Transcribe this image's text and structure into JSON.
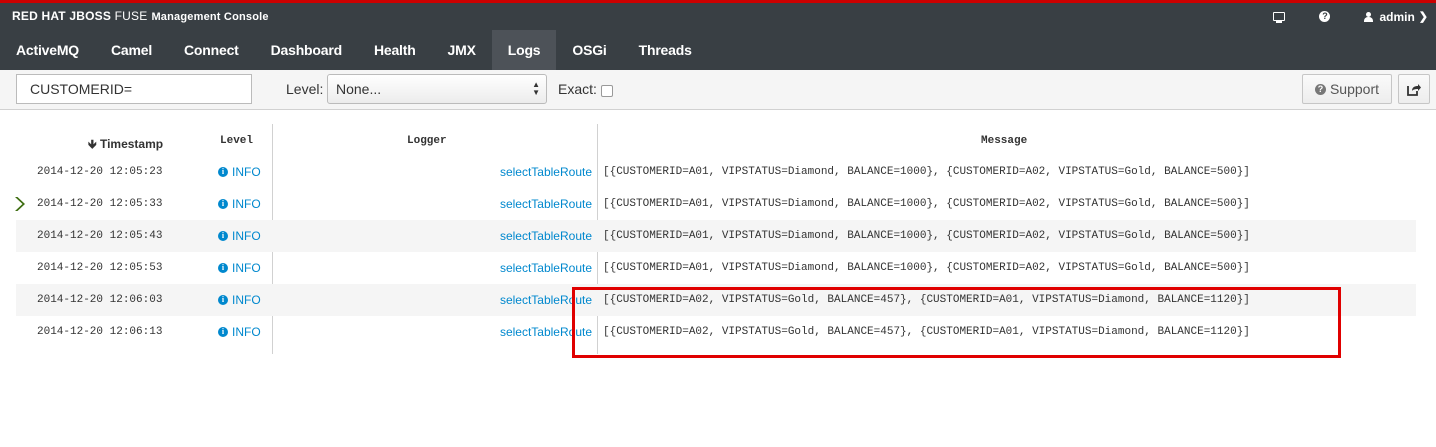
{
  "brand": {
    "redhat": "RED HAT",
    "jboss": "JBOSS",
    "fuse": "FUSE",
    "console": "Management Console"
  },
  "header": {
    "user": "admin",
    "icons": [
      "monitor-icon",
      "help-icon",
      "user-icon",
      "chevron-down-icon"
    ]
  },
  "nav": {
    "items": [
      "ActiveMQ",
      "Camel",
      "Connect",
      "Dashboard",
      "Health",
      "JMX",
      "Logs",
      "OSGi",
      "Threads"
    ],
    "active": "Logs"
  },
  "toolbar": {
    "search_value": "CUSTOMERID=",
    "level_label": "Level:",
    "level_value": "None...",
    "exact_label": "Exact:",
    "exact_checked": false,
    "support_label": "Support"
  },
  "table": {
    "headers": {
      "timestamp": "Timestamp",
      "level": "Level",
      "logger": "Logger",
      "message": "Message"
    },
    "sort_indicator": "arrow-down-icon",
    "rows": [
      {
        "timestamp": "2014-12-20 12:05:23",
        "level": "INFO",
        "logger": "selectTableRoute",
        "message": "[{CUSTOMERID=A01, VIPSTATUS=Diamond, BALANCE=1000}, {CUSTOMERID=A02, VIPSTATUS=Gold, BALANCE=500}]"
      },
      {
        "timestamp": "2014-12-20 12:05:33",
        "level": "INFO",
        "logger": "selectTableRoute",
        "message": "[{CUSTOMERID=A01, VIPSTATUS=Diamond, BALANCE=1000}, {CUSTOMERID=A02, VIPSTATUS=Gold, BALANCE=500}]"
      },
      {
        "timestamp": "2014-12-20 12:05:43",
        "level": "INFO",
        "logger": "selectTableRoute",
        "message": "[{CUSTOMERID=A01, VIPSTATUS=Diamond, BALANCE=1000}, {CUSTOMERID=A02, VIPSTATUS=Gold, BALANCE=500}]"
      },
      {
        "timestamp": "2014-12-20 12:05:53",
        "level": "INFO",
        "logger": "selectTableRoute",
        "message": "[{CUSTOMERID=A01, VIPSTATUS=Diamond, BALANCE=1000}, {CUSTOMERID=A02, VIPSTATUS=Gold, BALANCE=500}]"
      },
      {
        "timestamp": "2014-12-20 12:06:03",
        "level": "INFO",
        "logger": "selectTableRoute",
        "message": "[{CUSTOMERID=A02, VIPSTATUS=Gold, BALANCE=457}, {CUSTOMERID=A01, VIPSTATUS=Diamond, BALANCE=1120}]"
      },
      {
        "timestamp": "2014-12-20 12:06:13",
        "level": "INFO",
        "logger": "selectTableRoute",
        "message": "[{CUSTOMERID=A02, VIPSTATUS=Gold, BALANCE=457}, {CUSTOMERID=A01, VIPSTATUS=Diamond, BALANCE=1120}]"
      }
    ],
    "selected_row": 1
  },
  "colors": {
    "accent_red": "#cc0000",
    "nav_bg": "#393f44",
    "link_blue": "#0088ce",
    "highlight": "#e00000",
    "selection_arrow": "#3f6e12"
  }
}
